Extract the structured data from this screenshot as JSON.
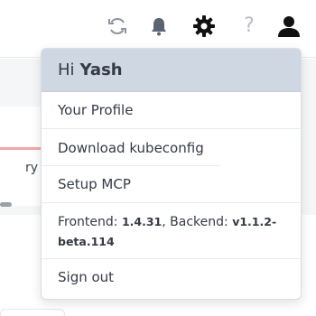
{
  "topbar": {
    "icons": [
      "refresh-icon",
      "bell-icon",
      "gear-icon",
      "help-icon",
      "user-icon"
    ],
    "help_glyph": "?"
  },
  "background": {
    "partial_text": "ry"
  },
  "menu": {
    "greeting": "Hi",
    "user_name": "Yash",
    "items": {
      "profile": "Your Profile",
      "download": "Download kubeconfig",
      "setup": "Setup MCP",
      "signout": "Sign out"
    },
    "version": {
      "frontend_label": "Frontend:",
      "frontend_value": "1.4.31",
      "separator": ",",
      "backend_label": "Backend:",
      "backend_value": "v1.1.2-beta.114"
    }
  },
  "colors": {
    "header_bg": "#cfd7e3",
    "icon_dark": "#111111",
    "icon_gray": "#5b6472"
  }
}
